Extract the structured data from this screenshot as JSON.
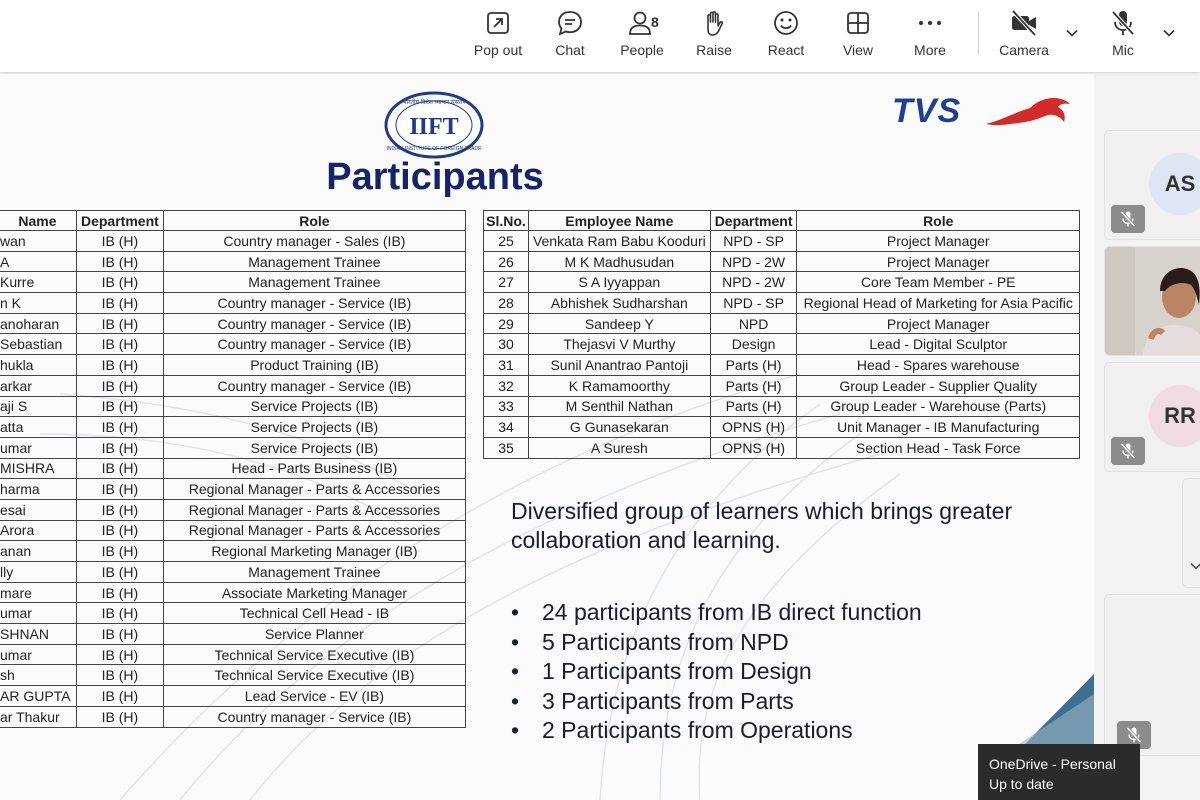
{
  "toolbar": {
    "popout": {
      "label": "Pop out",
      "icon": "pop-out-icon"
    },
    "chat": {
      "label": "Chat",
      "icon": "chat-icon"
    },
    "people": {
      "label": "People",
      "icon": "people-icon",
      "count": "8"
    },
    "raise": {
      "label": "Raise",
      "icon": "raise-hand-icon"
    },
    "react": {
      "label": "React",
      "icon": "smiley-icon"
    },
    "view": {
      "label": "View",
      "icon": "grid-view-icon"
    },
    "more": {
      "label": "More",
      "icon": "more-dots-icon"
    },
    "camera": {
      "label": "Camera",
      "icon": "camera-off-icon"
    },
    "mic": {
      "label": "Mic",
      "icon": "mic-off-icon"
    }
  },
  "slide": {
    "title": "Participants",
    "tvs_logo": "TVS",
    "iift_logo_text": "INDIAN INSTITUTE OF FOREIGN TRADE",
    "left_table": {
      "headers": [
        "Name",
        "Department",
        "Role"
      ],
      "rows": [
        [
          "wan",
          "IB (H)",
          "Country manager - Sales (IB)"
        ],
        [
          "A",
          "IB (H)",
          "Management Trainee"
        ],
        [
          "Kurre",
          "IB (H)",
          "Management Trainee"
        ],
        [
          "n K",
          "IB (H)",
          "Country manager - Service (IB)"
        ],
        [
          "anoharan",
          "IB (H)",
          "Country manager - Service (IB)"
        ],
        [
          "Sebastian",
          "IB (H)",
          "Country manager - Service (IB)"
        ],
        [
          "hukla",
          "IB (H)",
          "Product Training (IB)"
        ],
        [
          "arkar",
          "IB (H)",
          "Country manager - Service (IB)"
        ],
        [
          "aji S",
          "IB (H)",
          "Service Projects (IB)"
        ],
        [
          "atta",
          "IB (H)",
          "Service Projects (IB)"
        ],
        [
          "umar",
          "IB (H)",
          "Service Projects (IB)"
        ],
        [
          "MISHRA",
          "IB (H)",
          "Head - Parts Business (IB)"
        ],
        [
          "harma",
          "IB (H)",
          "Regional Manager - Parts & Accessories"
        ],
        [
          "esai",
          "IB (H)",
          "Regional Manager - Parts & Accessories"
        ],
        [
          "Arora",
          "IB (H)",
          "Regional Manager - Parts & Accessories"
        ],
        [
          "anan",
          "IB (H)",
          "Regional Marketing Manager (IB)"
        ],
        [
          "lly",
          "IB (H)",
          "Management Trainee"
        ],
        [
          "mare",
          "IB (H)",
          "Associate Marketing Manager"
        ],
        [
          "umar",
          "IB (H)",
          "Technical Cell Head - IB"
        ],
        [
          "SHNAN",
          "IB (H)",
          "Service Planner"
        ],
        [
          "umar",
          "IB (H)",
          "Technical Service Executive (IB)"
        ],
        [
          "sh",
          "IB (H)",
          "Technical Service Executive (IB)"
        ],
        [
          "AR GUPTA",
          "IB (H)",
          "Lead Service - EV (IB)"
        ],
        [
          "ar Thakur",
          "IB (H)",
          "Country manager - Service (IB)"
        ]
      ]
    },
    "right_table": {
      "headers": [
        "Sl.No.",
        "Employee Name",
        "Department",
        "Role"
      ],
      "rows": [
        [
          "25",
          "Venkata Ram Babu Kooduri",
          "NPD - SP",
          "Project Manager"
        ],
        [
          "26",
          "M K Madhusudan",
          "NPD - 2W",
          "Project Manager"
        ],
        [
          "27",
          "S A Iyyappan",
          "NPD - 2W",
          "Core Team Member - PE"
        ],
        [
          "28",
          "Abhishek Sudharshan",
          "NPD - SP",
          "Regional Head of Marketing for Asia Pacific"
        ],
        [
          "29",
          "Sandeep Y",
          "NPD",
          "Project Manager"
        ],
        [
          "30",
          "Thejasvi V Murthy",
          "Design",
          "Lead - Digital Sculptor"
        ],
        [
          "31",
          "Sunil Anantrao Pantoji",
          "Parts (H)",
          "Head - Spares warehouse"
        ],
        [
          "32",
          "K Ramamoorthy",
          "Parts (H)",
          "Group Leader - Supplier Quality"
        ],
        [
          "33",
          "M Senthil Nathan",
          "Parts (H)",
          "Group Leader - Warehouse (Parts)"
        ],
        [
          "34",
          "G Gunasekaran",
          "OPNS (H)",
          "Unit Manager - IB Manufacturing"
        ],
        [
          "35",
          "A Suresh",
          "OPNS (H)",
          "Section Head - Task Force"
        ]
      ]
    },
    "description": "Diversified group of learners which brings greater collaboration and learning.",
    "bullets": [
      "24 participants from IB direct function",
      "5 Participants from NPD",
      "1 Participants from Design",
      "3 Participants from Parts",
      "2 Participants from Operations"
    ],
    "bullet_char": "•"
  },
  "participants": [
    {
      "initials": "AS",
      "muted": true
    },
    {
      "initials": "",
      "video": true
    },
    {
      "initials": "RR",
      "muted": true
    },
    {
      "initials": "",
      "muted": false
    },
    {
      "initials": "",
      "muted": true
    }
  ],
  "toast": {
    "line1": "OneDrive - Personal",
    "line2": "Up to date"
  },
  "colors": {
    "title": "#15236d",
    "tvs_blue": "#1f3f95",
    "tvs_red": "#d42a2a",
    "toolbar_bg": "#ffffff"
  }
}
